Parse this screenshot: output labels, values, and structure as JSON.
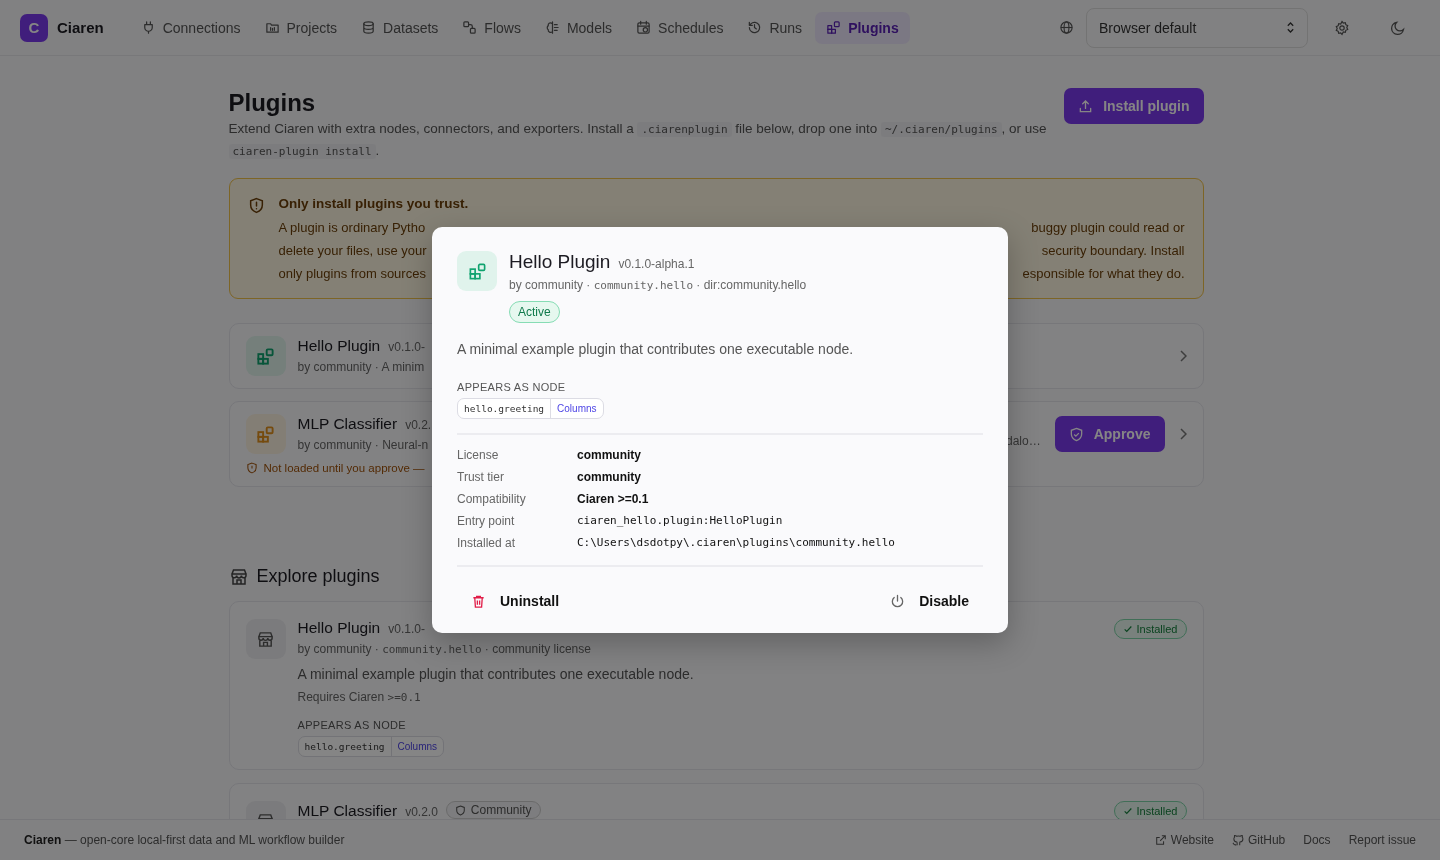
{
  "nav": {
    "brand": {
      "initial": "C",
      "name": "Ciaren"
    },
    "items": [
      {
        "label": "Connections",
        "selected": false
      },
      {
        "label": "Projects",
        "selected": false
      },
      {
        "label": "Datasets",
        "selected": false
      },
      {
        "label": "Flows",
        "selected": false
      },
      {
        "label": "Models",
        "selected": false
      },
      {
        "label": "Schedules",
        "selected": false
      },
      {
        "label": "Runs",
        "selected": false
      },
      {
        "label": "Plugins",
        "selected": true
      }
    ],
    "language": {
      "value": "Browser default"
    }
  },
  "page": {
    "title": "Plugins",
    "install_button": "Install plugin",
    "intro": [
      {
        "text": "Extend Ciaren with extra nodes, connectors, and exporters. Install a ",
        "code": false
      },
      {
        "text": ".ciarenplugin",
        "code": true
      },
      {
        "text": " file below, drop one into ",
        "code": false
      },
      {
        "text": "~/.ciaren/plugins",
        "code": true
      },
      {
        "text": ", or use ",
        "code": false
      },
      {
        "text": "ciaren-plugin install",
        "code": true
      },
      {
        "text": ".",
        "code": false
      }
    ]
  },
  "warning": {
    "title": "Only install plugins you trust.",
    "lines": [
      {
        "left": "A plugin is ordinary Pytho",
        "right": "buggy plugin could read or"
      },
      {
        "left": "delete your files, use your",
        "right": "security boundary. Install"
      },
      {
        "left": "only plugins from sources",
        "right": "esponsible for what they do."
      }
    ]
  },
  "installed": [
    {
      "name": "Hello Plugin",
      "version": "v0.1.0-",
      "meta": "by community · A minim",
      "approved": true
    },
    {
      "name": "MLP Classifier",
      "version": "v0.2.",
      "meta": "by community · Neural-n",
      "approved": false,
      "note": "Not loaded until you approve —",
      "note_right": "dalo…",
      "approve": "Approve"
    }
  ],
  "explore": {
    "title": "Explore plugins",
    "cards": [
      {
        "name": "Hello Plugin",
        "version": "v0.1.0-",
        "meta": [
          {
            "text": "by community · ",
            "code": false
          },
          {
            "text": "community.hello",
            "code": true
          },
          {
            "text": " · community license",
            "code": false
          }
        ],
        "description": "A minimal example plugin that contributes one executable node.",
        "requires": [
          {
            "text": "Requires Ciaren ",
            "code": false
          },
          {
            "text": ">=0.1",
            "code": true
          }
        ],
        "section": "APPEARS AS NODE",
        "node": {
          "id": "hello.greeting",
          "category": "Columns"
        },
        "badge": "Installed"
      },
      {
        "name": "MLP Classifier",
        "version": "v0.2.0",
        "tier": "Community",
        "badge": "Installed"
      }
    ]
  },
  "modal": {
    "name": "Hello Plugin",
    "version": "v0.1.0-alpha.1",
    "meta": [
      {
        "text": "by community · ",
        "code": false
      },
      {
        "text": "community.hello",
        "code": true
      },
      {
        "text": " · dir:community.hello",
        "code": false
      }
    ],
    "status": "Active",
    "description": "A minimal example plugin that contributes one executable node.",
    "section": "APPEARS AS NODE",
    "node": {
      "id": "hello.greeting",
      "category": "Columns"
    },
    "details": [
      {
        "label": "License",
        "value": "community",
        "mono": false
      },
      {
        "label": "Trust tier",
        "value": "community",
        "mono": false
      },
      {
        "label": "Compatibility",
        "value": "Ciaren >=0.1",
        "mono": false
      },
      {
        "label": "Entry point",
        "value": "ciaren_hello.plugin:HelloPlugin",
        "mono": true
      },
      {
        "label": "Installed at",
        "value": "C:\\Users\\dsdotpy\\.ciaren\\plugins\\community.hello",
        "mono": true
      }
    ],
    "uninstall": "Uninstall",
    "disable": "Disable"
  },
  "footer": {
    "brand": "Ciaren",
    "tagline": "— open-core local-first data and ML workflow builder",
    "links": [
      "Website",
      "GitHub",
      "Docs",
      "Report issue"
    ]
  }
}
